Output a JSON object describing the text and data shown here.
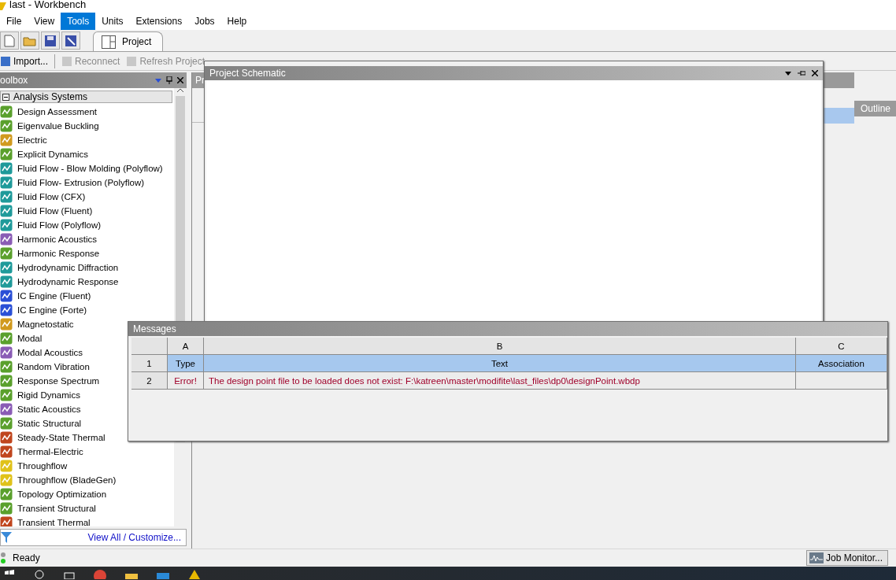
{
  "window": {
    "title": "last - Workbench"
  },
  "menu": [
    {
      "label": "File",
      "selected": false
    },
    {
      "label": "View",
      "selected": false
    },
    {
      "label": "Tools",
      "selected": true
    },
    {
      "label": "Units",
      "selected": false
    },
    {
      "label": "Extensions",
      "selected": false
    },
    {
      "label": "Jobs",
      "selected": false
    },
    {
      "label": "Help",
      "selected": false
    }
  ],
  "tabs": [
    {
      "label": "Project",
      "selected": true
    }
  ],
  "toolbar": [
    {
      "label": "Import...",
      "disabled": false
    },
    {
      "label": "Reconnect",
      "disabled": true
    },
    {
      "label": "Refresh Project",
      "disabled": true
    }
  ],
  "toolbox": {
    "title": "oolbox",
    "group": {
      "label": "Analysis Systems",
      "expanded": true
    },
    "items": [
      {
        "label": "Design Assessment",
        "color": "#5aa02c"
      },
      {
        "label": "Eigenvalue Buckling",
        "color": "#5aa02c"
      },
      {
        "label": "Electric",
        "color": "#d19a1e"
      },
      {
        "label": "Explicit Dynamics",
        "color": "#5aa02c"
      },
      {
        "label": "Fluid Flow - Blow Molding (Polyflow)",
        "color": "#1f9a9a"
      },
      {
        "label": "Fluid Flow- Extrusion (Polyflow)",
        "color": "#1f9a9a"
      },
      {
        "label": "Fluid Flow (CFX)",
        "color": "#1f9a9a"
      },
      {
        "label": "Fluid Flow (Fluent)",
        "color": "#1f9a9a"
      },
      {
        "label": "Fluid Flow (Polyflow)",
        "color": "#1f9a9a"
      },
      {
        "label": "Harmonic Acoustics",
        "color": "#8a5cb5"
      },
      {
        "label": "Harmonic Response",
        "color": "#5aa02c"
      },
      {
        "label": "Hydrodynamic Diffraction",
        "color": "#1f9a9a"
      },
      {
        "label": "Hydrodynamic Response",
        "color": "#1f9a9a"
      },
      {
        "label": "IC Engine (Fluent)",
        "color": "#2a4fd6"
      },
      {
        "label": "IC Engine (Forte)",
        "color": "#2a4fd6"
      },
      {
        "label": "Magnetostatic",
        "color": "#d19a1e"
      },
      {
        "label": "Modal",
        "color": "#5aa02c"
      },
      {
        "label": "Modal Acoustics",
        "color": "#8a5cb5"
      },
      {
        "label": "Random Vibration",
        "color": "#5aa02c"
      },
      {
        "label": "Response Spectrum",
        "color": "#5aa02c"
      },
      {
        "label": "Rigid Dynamics",
        "color": "#5aa02c"
      },
      {
        "label": "Static Acoustics",
        "color": "#8a5cb5"
      },
      {
        "label": "Static Structural",
        "color": "#5aa02c"
      },
      {
        "label": "Steady-State Thermal",
        "color": "#c0461e"
      },
      {
        "label": "Thermal-Electric",
        "color": "#c0461e"
      },
      {
        "label": "Throughflow",
        "color": "#e0c21a"
      },
      {
        "label": "Throughflow (BladeGen)",
        "color": "#e0c21a"
      },
      {
        "label": "Topology Optimization",
        "color": "#5aa02c"
      },
      {
        "label": "Transient Structural",
        "color": "#5aa02c"
      },
      {
        "label": "Transient Thermal",
        "color": "#c0461e"
      }
    ],
    "footer_link": "View All / Customize..."
  },
  "project_panel": {
    "title": "Pr"
  },
  "outline_panel": {
    "title": "Outline"
  },
  "schematic": {
    "title": "Project Schematic"
  },
  "messages": {
    "title": "Messages",
    "columns": [
      "A",
      "B",
      "C"
    ],
    "rows": [
      {
        "number": "1",
        "cells": [
          "Type",
          "Text",
          "Association"
        ],
        "selected": true
      },
      {
        "number": "2",
        "cells": [
          "Error!",
          "The design point file to be loaded does not exist: F:\\katreen\\master\\modifite\\last_files\\dp0\\designPoint.wbdp",
          ""
        ],
        "selected": false,
        "kind": "error"
      }
    ]
  },
  "status_bar": {
    "text": "Ready",
    "job_monitor": "Job Monitor..."
  }
}
